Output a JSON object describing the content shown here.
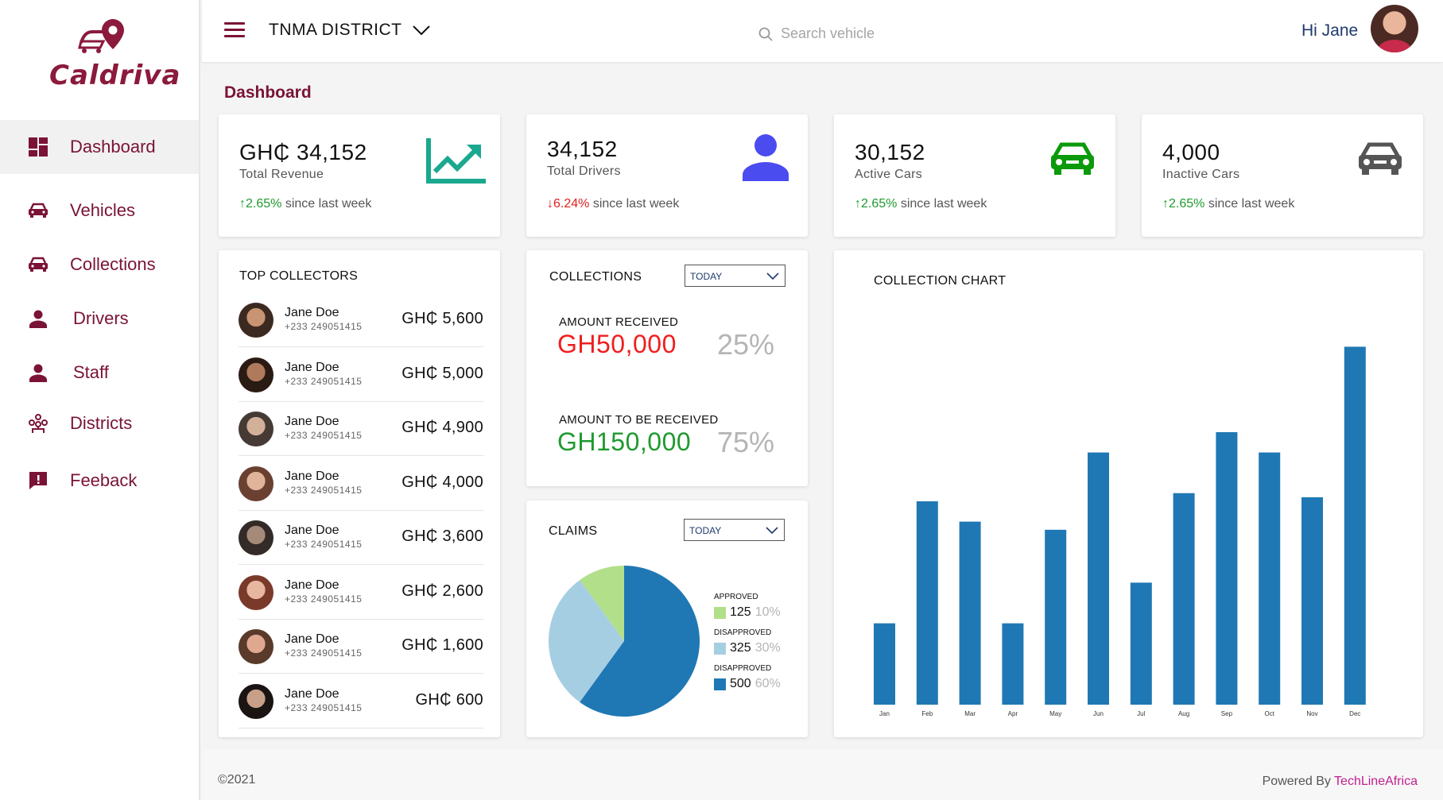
{
  "brand": {
    "name": "Caldriva"
  },
  "nav": [
    {
      "label": "Dashboard",
      "icon": "dashboard-icon",
      "active": true
    },
    {
      "label": "Vehicles",
      "icon": "car-icon"
    },
    {
      "label": "Collections",
      "icon": "car-icon"
    },
    {
      "label": "Drivers",
      "icon": "person-icon"
    },
    {
      "label": "Staff",
      "icon": "person-icon"
    },
    {
      "label": "Districts",
      "icon": "districts-icon"
    },
    {
      "label": "Feeback",
      "icon": "feedback-icon"
    }
  ],
  "topbar": {
    "district": "TNMA DISTRICT",
    "search_placeholder": "Search vehicle",
    "greeting": "Hi Jane"
  },
  "page_title": "Dashboard",
  "stats": [
    {
      "value": "GH₵ 34,152",
      "label": "Total Revenue",
      "change": "2.65%",
      "direction": "up",
      "since": " since last week",
      "icon": "trend-up-icon",
      "icon_color": "#1aa88e"
    },
    {
      "value": "34,152",
      "label": "Total Drivers",
      "change": "6.24%",
      "direction": "down",
      "since": " since last week",
      "icon": "person-icon",
      "icon_color": "#4a4cf0"
    },
    {
      "value": "30,152",
      "label": "Active Cars",
      "change": "2.65%",
      "direction": "up",
      "since": " since last week",
      "icon": "car-icon",
      "icon_color": "#0a9a0a"
    },
    {
      "value": "4,000",
      "label": "Inactive Cars",
      "change": "2.65%",
      "direction": "up",
      "since": " since last week",
      "icon": "car-icon",
      "icon_color": "#555555"
    }
  ],
  "top_collectors": {
    "title": "TOP COLLECTORS",
    "rows": [
      {
        "name": "Jane Doe",
        "phone": "+233 249051415",
        "amount": "GH₵ 5,600"
      },
      {
        "name": "Jane Doe",
        "phone": "+233 249051415",
        "amount": "GH₵ 5,000"
      },
      {
        "name": "Jane Doe",
        "phone": "+233 249051415",
        "amount": "GH₵ 4,900"
      },
      {
        "name": "Jane Doe",
        "phone": "+233 249051415",
        "amount": "GH₵ 4,000"
      },
      {
        "name": "Jane Doe",
        "phone": "+233 249051415",
        "amount": "GH₵ 3,600"
      },
      {
        "name": "Jane Doe",
        "phone": "+233 249051415",
        "amount": "GH₵ 2,600"
      },
      {
        "name": "Jane Doe",
        "phone": "+233 249051415",
        "amount": "GH₵ 1,600"
      },
      {
        "name": "Jane Doe",
        "phone": "+233 249051415",
        "amount": "GH₵ 600"
      }
    ]
  },
  "collections": {
    "title": "COLLECTIONS",
    "filter": "TODAY",
    "received_label": "AMOUNT RECEIVED",
    "received_value": "GH50,000",
    "received_pct": "25%",
    "received_color": "#f01e1e",
    "pending_label": "AMOUNT TO BE RECEIVED",
    "pending_value": "GH150,000",
    "pending_pct": "75%",
    "pending_color": "#1f9a2e"
  },
  "claims": {
    "title": "CLAIMS",
    "filter": "TODAY",
    "legend": [
      {
        "title": "APPROVED",
        "count": "125",
        "pct": "10%",
        "color": "#b2df8a"
      },
      {
        "title": "DISAPPROVED",
        "count": "325",
        "pct": "30%",
        "color": "#a6cee3"
      },
      {
        "title": "DISAPPROVED",
        "count": "500",
        "pct": "60%",
        "color": "#1f78b4"
      }
    ],
    "chart_data": {
      "type": "pie",
      "slices": [
        {
          "label": "APPROVED",
          "value": 10,
          "color": "#b2df8a"
        },
        {
          "label": "DISAPPROVED",
          "value": 30,
          "color": "#a6cee3"
        },
        {
          "label": "DISAPPROVED",
          "value": 60,
          "color": "#1f78b4"
        }
      ]
    }
  },
  "collection_chart": {
    "title": "COLLECTION CHART",
    "chart_data": {
      "type": "bar",
      "title": "COLLECTION CHART",
      "categories": [
        "Jan",
        "Feb",
        "Mar",
        "Apr",
        "May",
        "Jun",
        "Jul",
        "Aug",
        "Sep",
        "Oct",
        "Nov",
        "Dec"
      ],
      "values": [
        20,
        50,
        45,
        20,
        43,
        62,
        30,
        52,
        67,
        62,
        51,
        88
      ],
      "ylim": [
        0,
        100
      ],
      "color": "#1f78b4",
      "grid": false
    }
  },
  "footer": {
    "copyright": "©2021",
    "powered_prefix": "Powered By ",
    "powered_link": "TechLineAfrica"
  }
}
